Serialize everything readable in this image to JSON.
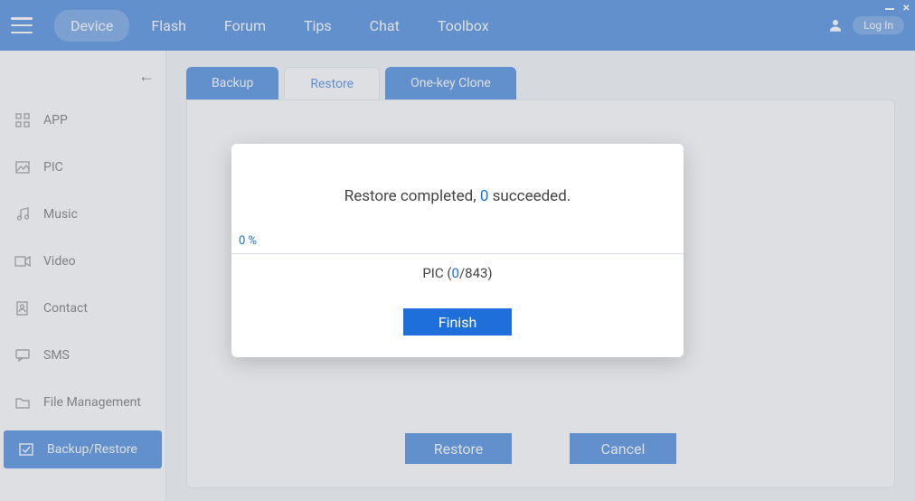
{
  "nav": {
    "items": [
      "Device",
      "Flash",
      "Forum",
      "Tips",
      "Chat",
      "Toolbox"
    ],
    "active": "Device",
    "login": "Log In"
  },
  "sidebar": {
    "items": [
      {
        "label": "APP"
      },
      {
        "label": "PIC"
      },
      {
        "label": "Music"
      },
      {
        "label": "Video"
      },
      {
        "label": "Contact"
      },
      {
        "label": "SMS"
      },
      {
        "label": "File Management"
      },
      {
        "label": "Backup/Restore"
      }
    ],
    "active_index": 7
  },
  "tabs": {
    "items": [
      "Backup",
      "Restore",
      "One-key Clone"
    ],
    "current_index": 1
  },
  "actions": {
    "restore": "Restore",
    "cancel": "Cancel"
  },
  "modal": {
    "prefix": "Restore completed, ",
    "succeeded_count": "0",
    "suffix": " succeeded.",
    "progress_pct": "0 %",
    "pic_label": "PIC (",
    "pic_done": "0",
    "pic_sep_total": "/843)",
    "finish": "Finish"
  }
}
